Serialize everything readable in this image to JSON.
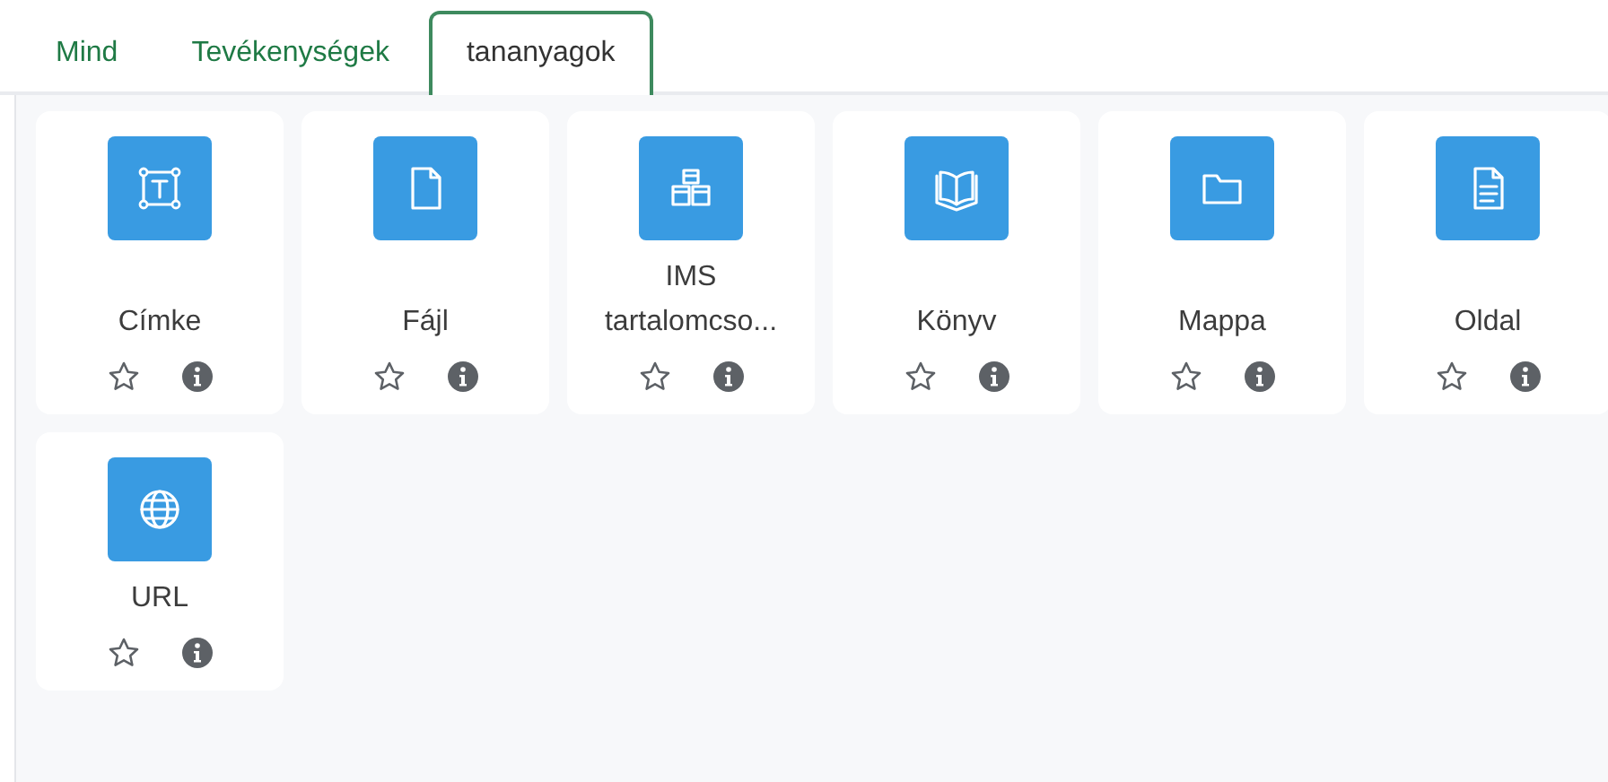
{
  "tabs": [
    {
      "label": "Mind",
      "selected": false
    },
    {
      "label": "Tevékenységek",
      "selected": false
    },
    {
      "label": "tananyagok",
      "selected": true
    }
  ],
  "items": [
    {
      "kind": "label",
      "title": "Címke",
      "starred": false
    },
    {
      "kind": "file",
      "title": "Fájl",
      "starred": false
    },
    {
      "kind": "package",
      "title": "IMS tartalomcso...",
      "starred": false
    },
    {
      "kind": "book",
      "title": "Könyv",
      "starred": false
    },
    {
      "kind": "folder",
      "title": "Mappa",
      "starred": false
    },
    {
      "kind": "page",
      "title": "Oldal",
      "starred": false
    },
    {
      "kind": "url",
      "title": "URL",
      "starred": false
    }
  ]
}
